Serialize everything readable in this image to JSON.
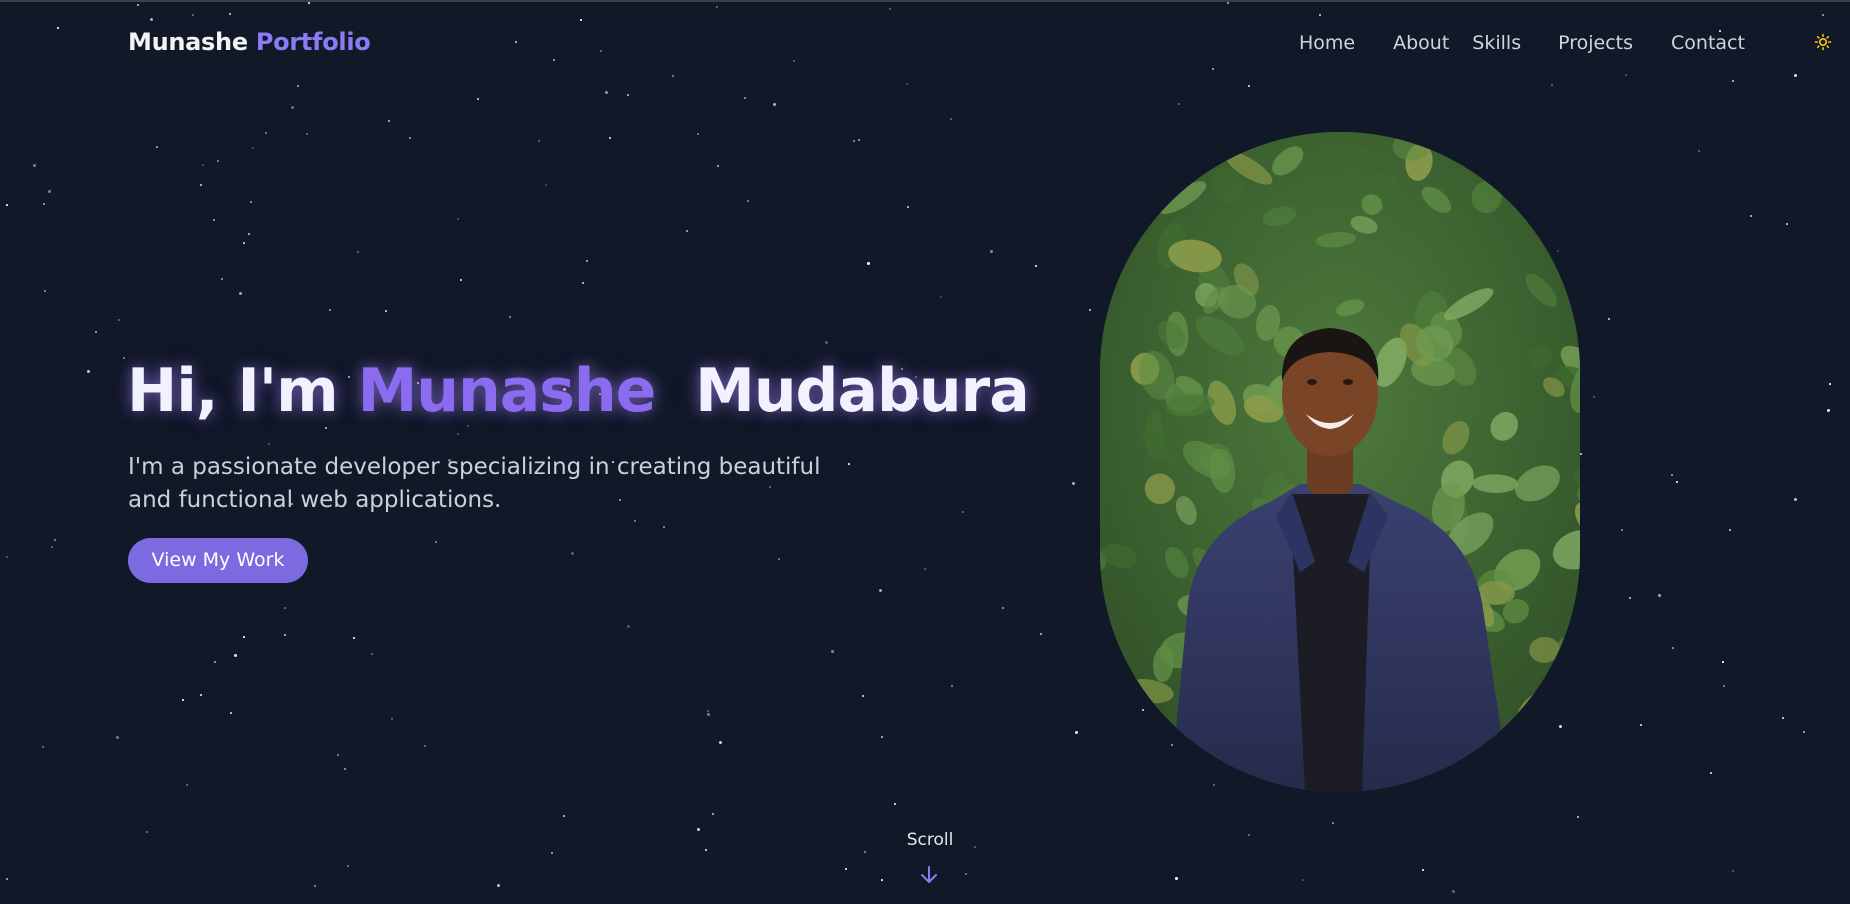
{
  "header": {
    "logo_first": "Munashe",
    "logo_second": "Portfolio",
    "nav": [
      "Home",
      "About",
      "Skills",
      "Projects",
      "Contact"
    ],
    "theme_icon": "sun-icon"
  },
  "hero": {
    "greeting": "Hi, I'm",
    "first_name": "Munashe",
    "last_name": "Mudabura",
    "description": "I'm a passionate developer specializing in creating beautiful and functional web applications.",
    "cta_label": "View My Work"
  },
  "portrait": {
    "icon": "profile-photo"
  },
  "scroll": {
    "label": "Scroll",
    "icon": "arrow-down-icon"
  },
  "colors": {
    "background": "#111827",
    "accent": "#8b6cf0",
    "button": "#7c6ae0"
  }
}
